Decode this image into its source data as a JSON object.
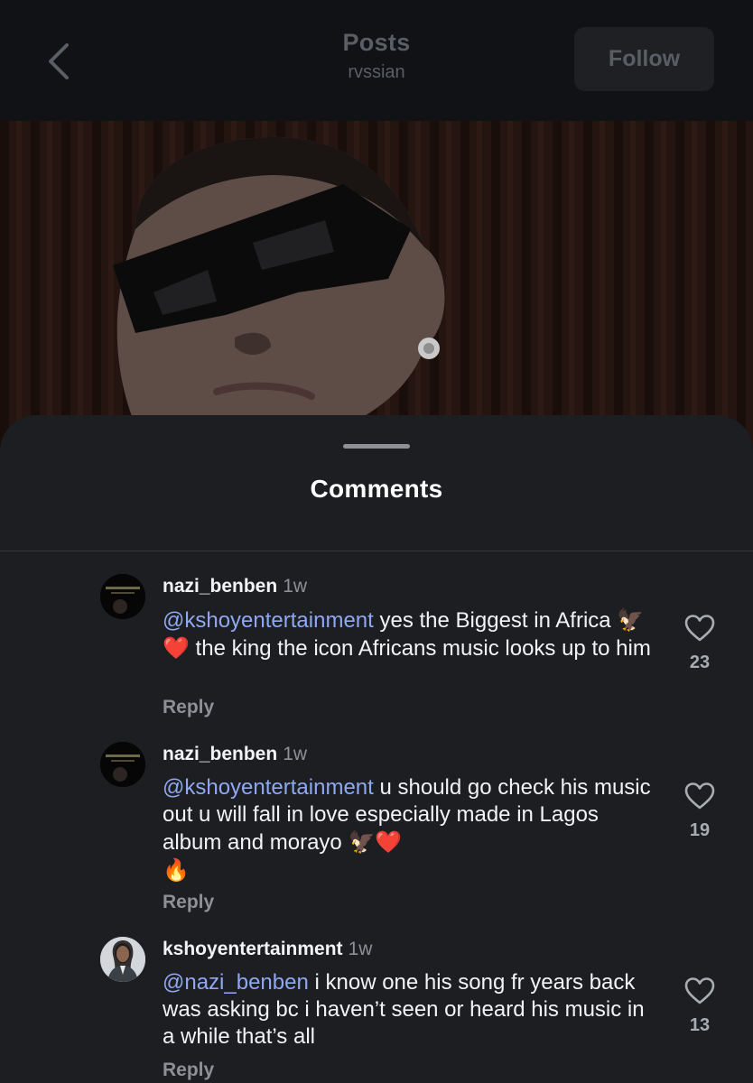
{
  "header": {
    "title": "Posts",
    "subtitle": "rvssian",
    "follow_label": "Follow"
  },
  "sheet": {
    "title": "Comments"
  },
  "comments": [
    {
      "username": "nazi_benben",
      "time": "1w",
      "mention": "@kshoyentertainment",
      "text_1": " yes the Biggest in Africa ",
      "emoji_1": "🦅❤️",
      "text_2": " the king the icon Africans music looks up to him",
      "emoji_2": "",
      "likes": "23",
      "reply_label": "Reply"
    },
    {
      "username": "nazi_benben",
      "time": "1w",
      "mention": "@kshoyentertainment",
      "text_1": " u should go check his music out u will fall in love especially made in Lagos album and morayo ",
      "emoji_1": "🦅❤️",
      "text_2": "",
      "emoji_2": "🔥",
      "likes": "19",
      "reply_label": "Reply"
    },
    {
      "username": "kshoyentertainment",
      "time": "1w",
      "mention": "@nazi_benben",
      "text_1": " i know one his song fr years back was asking bc i haven’t seen or heard his music in a while that’s all",
      "emoji_1": "",
      "text_2": "",
      "emoji_2": "",
      "likes": "13",
      "reply_label": "Reply"
    }
  ],
  "icons": {
    "back": "chevron-left-icon",
    "like": "heart-outline-icon"
  },
  "colors": {
    "mention": "#8fa8f2",
    "sheet_bg": "#1c1e22",
    "topbar_bg": "#101216"
  }
}
